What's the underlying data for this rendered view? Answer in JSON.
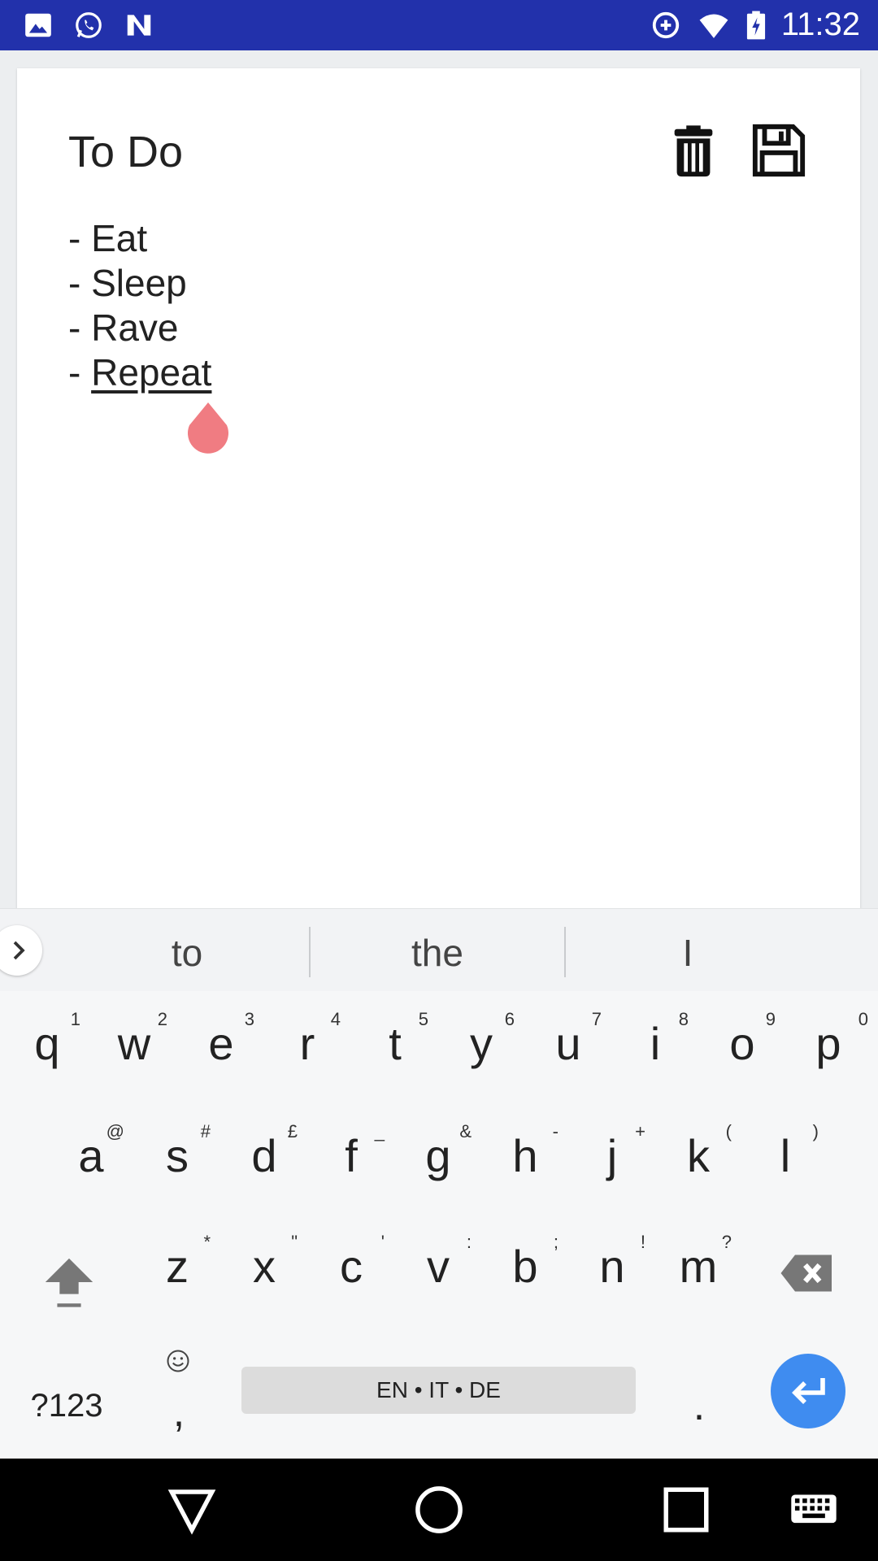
{
  "status_bar": {
    "time": "11:32",
    "left_icons": [
      "image-icon",
      "whatsapp-icon",
      "n-notification-icon"
    ],
    "right_icons": [
      "data-saver-icon",
      "wifi-icon",
      "battery-icon"
    ],
    "background": "#2231ab"
  },
  "note": {
    "title": "To Do",
    "lines": [
      "- Eat",
      "- Sleep",
      "- Rave",
      "- "
    ],
    "underlined_word": "Repeat",
    "actions": [
      "delete-icon",
      "save-icon"
    ]
  },
  "suggestions": [
    "to",
    "the",
    "I"
  ],
  "keyboard": {
    "row1": [
      {
        "key": "q",
        "hint": "1"
      },
      {
        "key": "w",
        "hint": "2"
      },
      {
        "key": "e",
        "hint": "3"
      },
      {
        "key": "r",
        "hint": "4"
      },
      {
        "key": "t",
        "hint": "5"
      },
      {
        "key": "y",
        "hint": "6"
      },
      {
        "key": "u",
        "hint": "7"
      },
      {
        "key": "i",
        "hint": "8"
      },
      {
        "key": "o",
        "hint": "9"
      },
      {
        "key": "p",
        "hint": "0"
      }
    ],
    "row2": [
      {
        "key": "a",
        "hint": "@"
      },
      {
        "key": "s",
        "hint": "#"
      },
      {
        "key": "d",
        "hint": "£"
      },
      {
        "key": "f",
        "hint": "_"
      },
      {
        "key": "g",
        "hint": "&"
      },
      {
        "key": "h",
        "hint": "-"
      },
      {
        "key": "j",
        "hint": "+"
      },
      {
        "key": "k",
        "hint": "("
      },
      {
        "key": "l",
        "hint": ")"
      }
    ],
    "row3": [
      {
        "key": "z",
        "hint": "*"
      },
      {
        "key": "x",
        "hint": "\""
      },
      {
        "key": "c",
        "hint": "'"
      },
      {
        "key": "v",
        "hint": ":"
      },
      {
        "key": "b",
        "hint": ";"
      },
      {
        "key": "n",
        "hint": "!"
      },
      {
        "key": "m",
        "hint": "?"
      }
    ],
    "symbols_label": "?123",
    "comma_label": ",",
    "space_label": "EN • IT • DE",
    "period_label": ".",
    "enter_color": "#3f8cf0"
  },
  "colors": {
    "cursor_handle": "#f07c82",
    "nav_bar": "#000000"
  }
}
